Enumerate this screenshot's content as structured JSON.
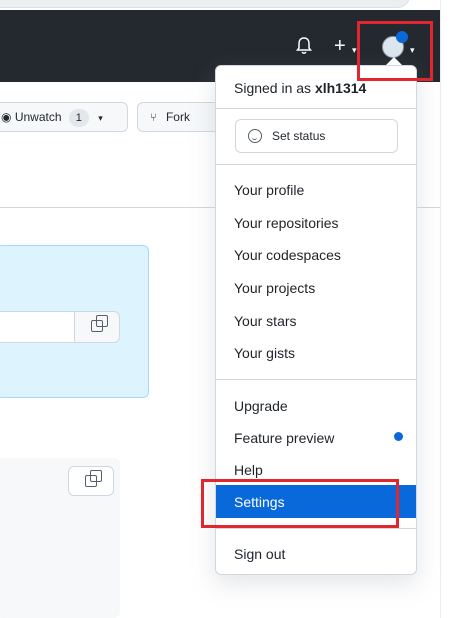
{
  "header": {
    "notifications_icon": "bell-icon",
    "create_icon": "plus-icon",
    "avatar_icon": "user-avatar-icon",
    "background": "#24292f"
  },
  "repo_actions": {
    "unwatch_label": "Unwatch",
    "unwatch_count": "1",
    "fork_label": "Fork"
  },
  "user_menu": {
    "signed_in_prefix": "Signed in as",
    "username": "xlh1314",
    "set_status_label": "Set status",
    "items_group1": [
      "Your profile",
      "Your repositories",
      "Your codespaces",
      "Your projects",
      "Your stars",
      "Your gists"
    ],
    "upgrade_label": "Upgrade",
    "feature_preview_label": "Feature preview",
    "help_label": "Help",
    "settings_label": "Settings",
    "sign_out_label": "Sign out",
    "selected_item": "Settings",
    "selected_color": "#0969da"
  },
  "annotation": {
    "highlight_color": "#e0272f"
  }
}
